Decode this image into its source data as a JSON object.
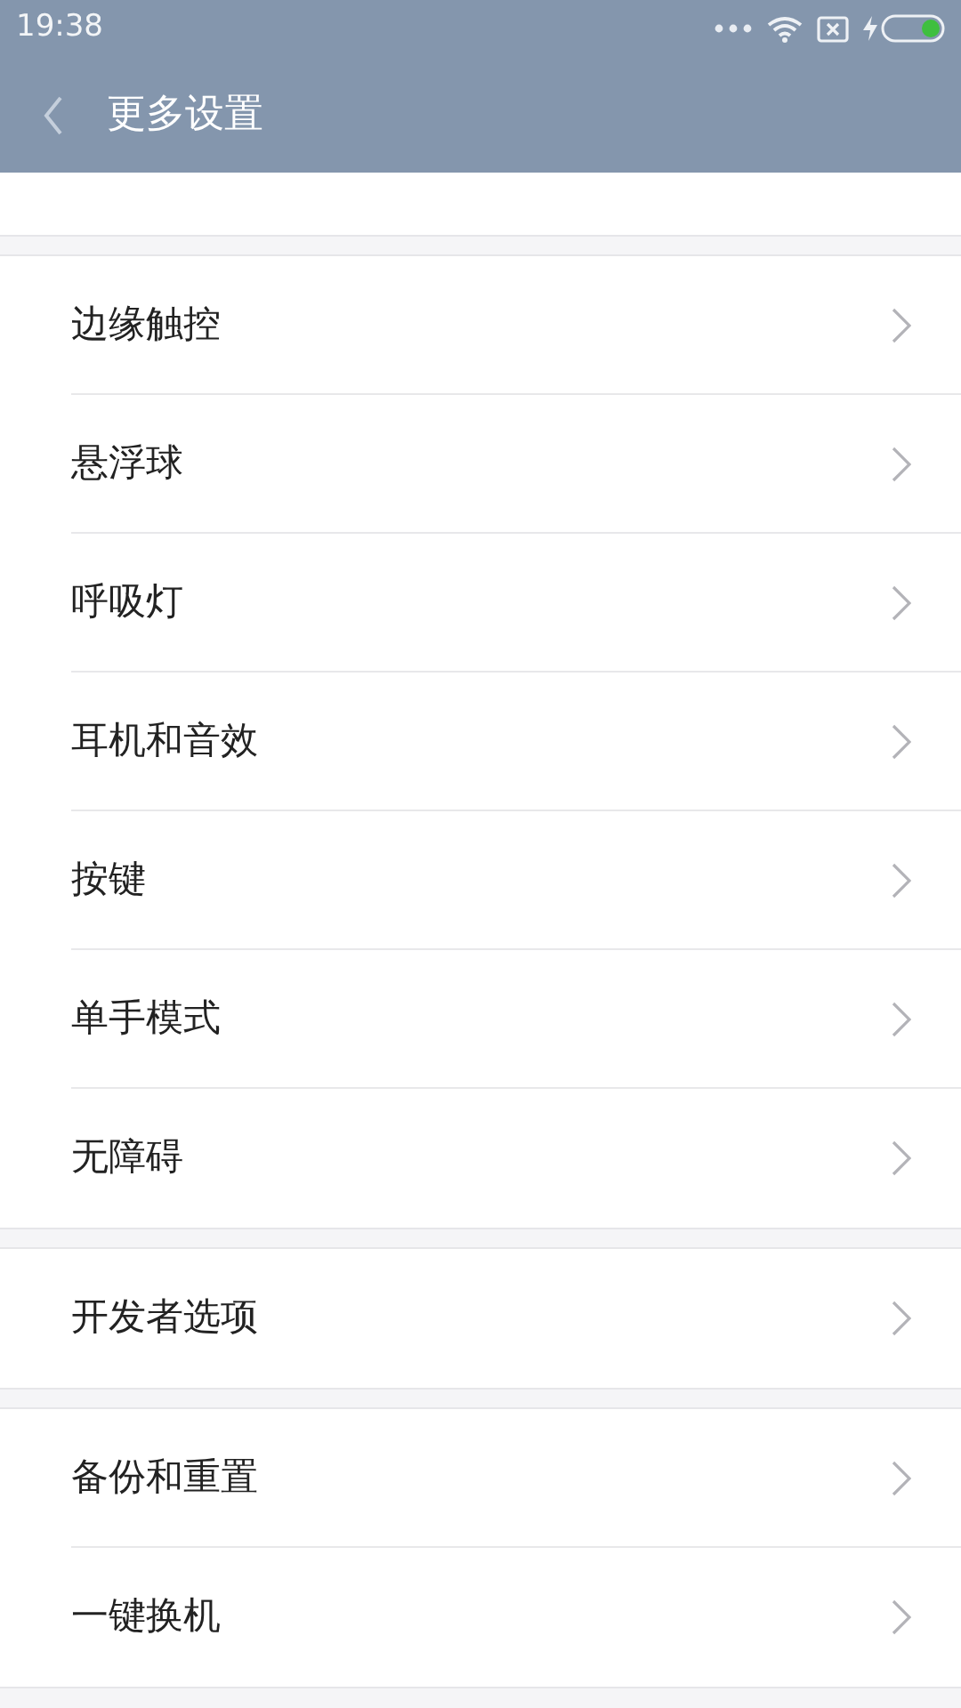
{
  "status_bar": {
    "time": "19:38"
  },
  "header": {
    "title": "更多设置"
  },
  "groups": [
    {
      "items": [
        {
          "label": "边缘触控"
        },
        {
          "label": "悬浮球"
        },
        {
          "label": "呼吸灯"
        },
        {
          "label": "耳机和音效"
        },
        {
          "label": "按键"
        },
        {
          "label": "单手模式"
        },
        {
          "label": "无障碍"
        }
      ]
    },
    {
      "items": [
        {
          "label": "开发者选项"
        }
      ]
    },
    {
      "items": [
        {
          "label": "备份和重置"
        },
        {
          "label": "一键换机"
        }
      ]
    }
  ]
}
